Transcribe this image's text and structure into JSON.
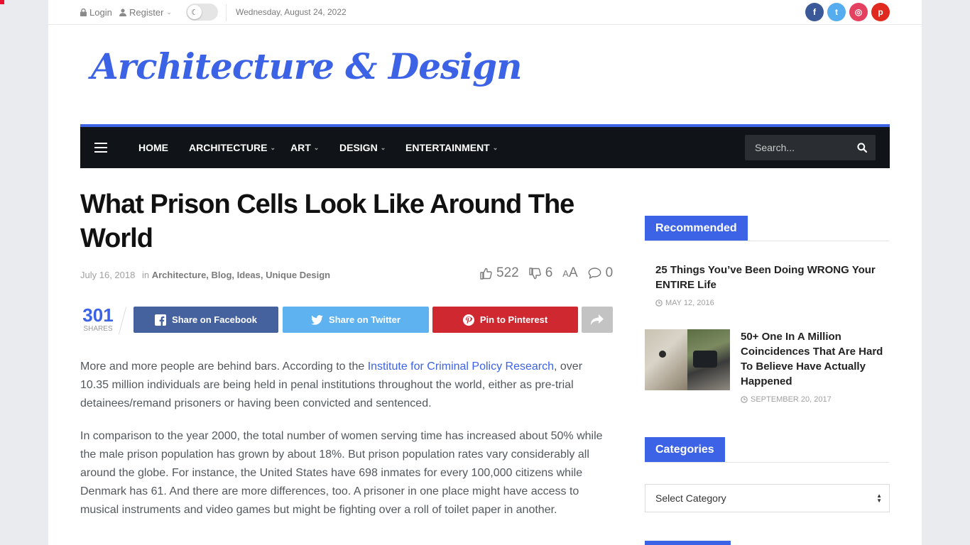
{
  "topbar": {
    "login": "Login",
    "register": "Register",
    "date": "Wednesday, August 24, 2022",
    "social": [
      {
        "name": "facebook",
        "glyph": "f",
        "color": "#3b5998"
      },
      {
        "name": "twitter",
        "glyph": "t",
        "color": "#55acee"
      },
      {
        "name": "instagram",
        "glyph": "◎",
        "color": "#e4405f"
      },
      {
        "name": "pinterest",
        "glyph": "p",
        "color": "#e02a20"
      }
    ]
  },
  "logo": "Architecture & Design",
  "nav": {
    "items": [
      {
        "label": "HOME",
        "dropdown": false
      },
      {
        "label": "ARCHITECTURE",
        "dropdown": true
      },
      {
        "label": "ART",
        "dropdown": true
      },
      {
        "label": "DESIGN",
        "dropdown": true
      },
      {
        "label": "ENTERTAINMENT",
        "dropdown": true
      }
    ],
    "search_placeholder": "Search..."
  },
  "article": {
    "title": "What Prison Cells Look Like Around The World",
    "date": "July 16, 2018",
    "in": "in",
    "categories": "Architecture, Blog, Ideas, Unique Design",
    "likes": "522",
    "dislikes": "6",
    "font_size_label": "AA",
    "comments": "0",
    "shares_count": "301",
    "shares_label": "SHARES",
    "share_buttons": [
      {
        "label": "Share on Facebook",
        "color": "#45629f",
        "icon": "facebook-icon"
      },
      {
        "label": "Share on Twitter",
        "color": "#5eb2ef",
        "icon": "twitter-icon"
      },
      {
        "label": "Pin to Pinterest",
        "color": "#cf2830",
        "icon": "pinterest-icon"
      }
    ],
    "p1_before": "More and more people are behind bars. According to the ",
    "p1_link": "Institute for Criminal Policy Research",
    "p1_after": ", over 10.35 million individuals are being held in penal institutions throughout the world, either as pre-trial detainees/remand prisoners or having been convicted and sentenced.",
    "p2": "In comparison to the year 2000, the total number of women serving time has increased about 50% while the male prison population has grown by about 18%. But prison population rates vary considerably all around the globe. For instance, the United States have 698 inmates for every 100,000 citizens while Denmark has 61. And there are more differences, too. A prisoner in one place might have access to musical instruments and video games but might be fighting over a roll of toilet paper in another."
  },
  "sidebar": {
    "recommended_title": "Recommended",
    "rec1_title": "25 Things You’ve Been Doing WRONG Your ENTIRE Life",
    "rec1_date": "MAY 12, 2016",
    "rec2_title": "50+ One In A Million Coincidences That Are Hard To Believe Have Actually Happened",
    "rec2_date": "SEPTEMBER 20, 2017",
    "categories_title": "Categories",
    "select_value": "Select Category"
  },
  "colors": {
    "accent": "#3c63e6",
    "nav_bg": "#101419"
  }
}
